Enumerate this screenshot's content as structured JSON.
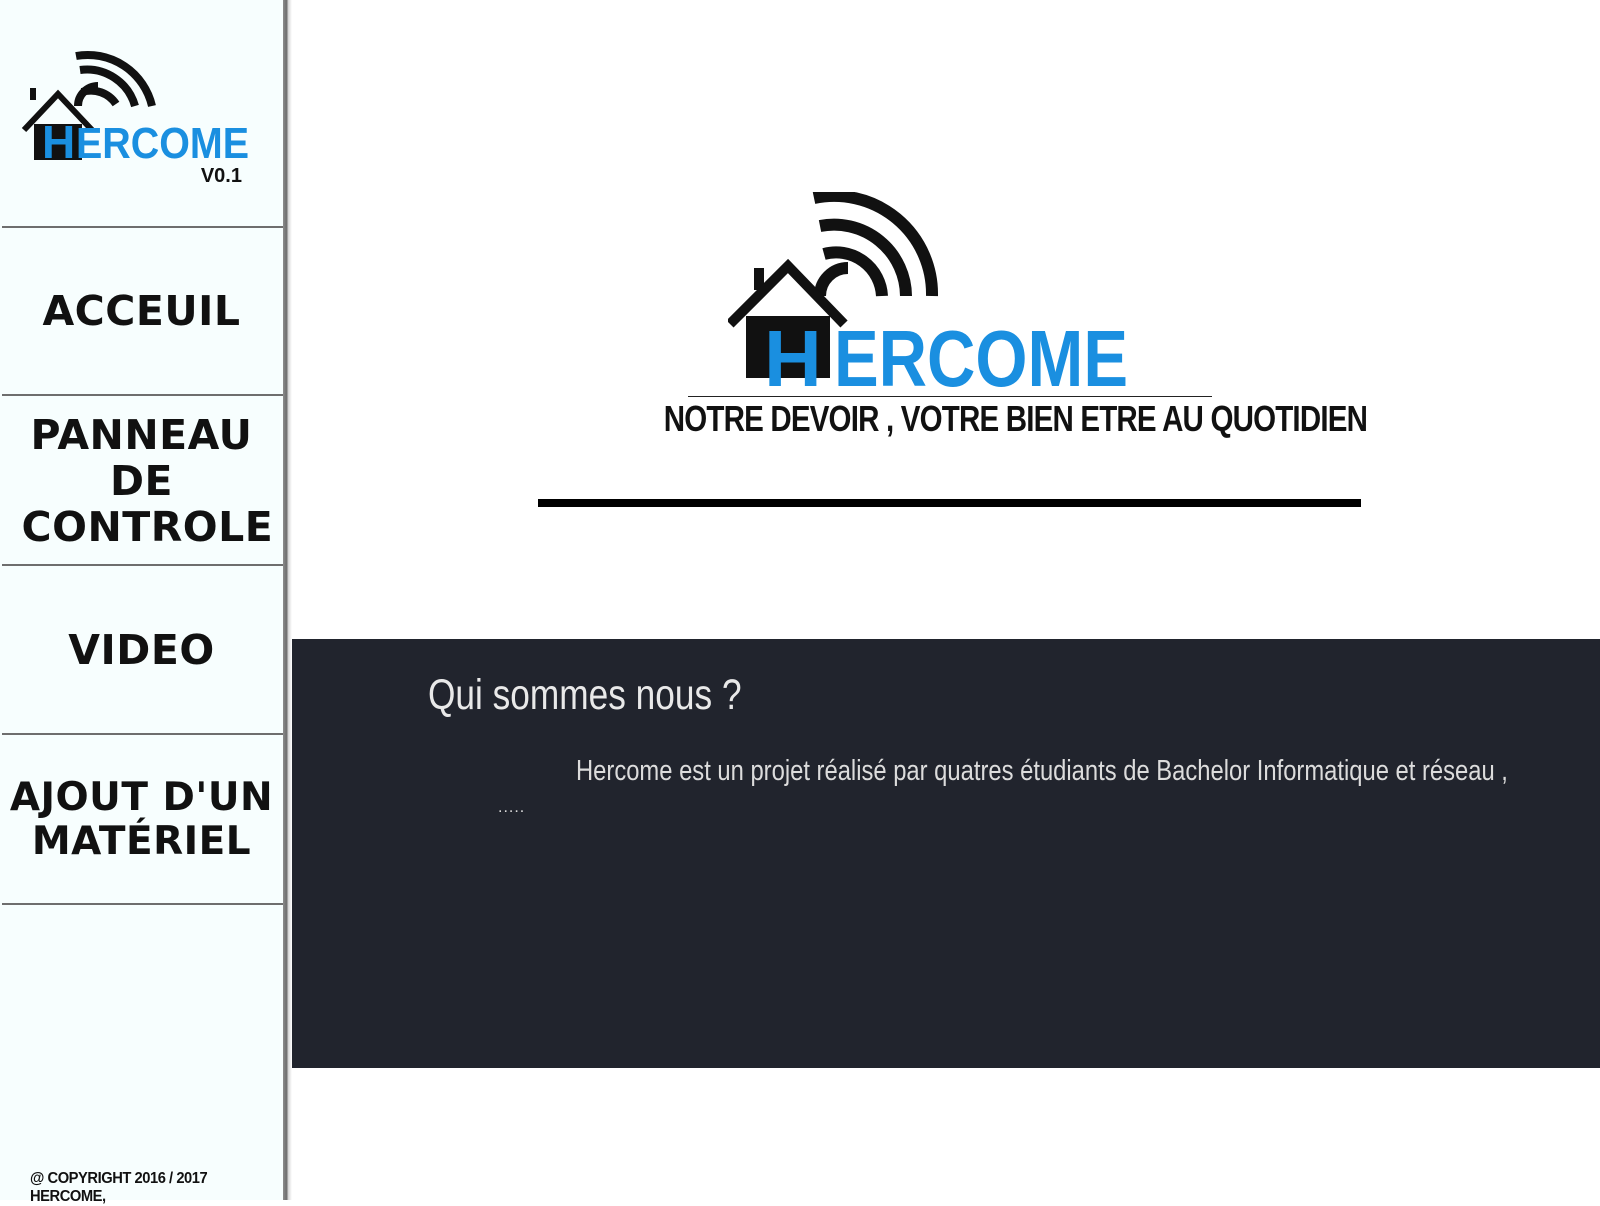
{
  "sidebar": {
    "logo": {
      "brand_first_letter": "H",
      "brand_rest": "ERCOME",
      "version": "V0.1"
    },
    "nav": [
      {
        "label": "ACCEUIL"
      },
      {
        "label": "PANNEAU DE CONTROLE"
      },
      {
        "label": "VIDEO"
      },
      {
        "label": "AJOUT D'UN MATÉRIEL"
      }
    ],
    "copyright": "@ COPYRIGHT 2016 / 2017 HERCOME,"
  },
  "hero": {
    "logo": {
      "brand_first_letter": "H",
      "brand_rest": "ERCOME"
    },
    "tagline": "NOTRE DEVOIR , VOTRE BIEN ETRE AU QUOTIDIEN"
  },
  "about": {
    "title": "Qui sommes nous ?",
    "text": "Hercome est un projet réalisé par quatres étudiants de Bachelor Informatique et réseau ,",
    "ellipsis": "....."
  },
  "colors": {
    "brand_blue": "#1a8fe0",
    "dark_section": "#21242d",
    "sidebar_bg": "#f7fefe",
    "logo_black": "#111111"
  }
}
